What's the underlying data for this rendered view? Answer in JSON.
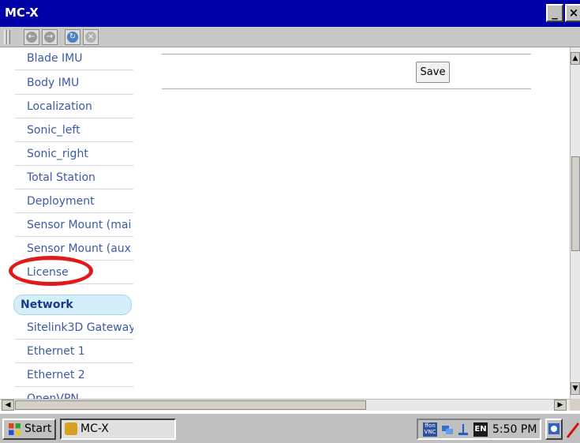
{
  "window": {
    "title": "MC-X",
    "minimize_label": "_",
    "close_label": "×"
  },
  "toolbar": {
    "back_glyph": "←",
    "forward_glyph": "→",
    "refresh_glyph": "↻",
    "stop_glyph": "×"
  },
  "sidebar": {
    "items": [
      {
        "label": "Blade IMU"
      },
      {
        "label": "Body IMU"
      },
      {
        "label": "Localization"
      },
      {
        "label": "Sonic_left"
      },
      {
        "label": "Sonic_right"
      },
      {
        "label": "Total Station"
      },
      {
        "label": "Deployment"
      },
      {
        "label": "Sensor Mount (mai"
      },
      {
        "label": "Sensor Mount (aux"
      },
      {
        "label": "License"
      }
    ],
    "section": {
      "label": "Network"
    },
    "network_items": [
      {
        "label": "Sitelink3D Gateway"
      },
      {
        "label": "Ethernet 1"
      },
      {
        "label": "Ethernet 2"
      },
      {
        "label": "OpenVPN"
      }
    ]
  },
  "content": {
    "save_label": "Save"
  },
  "annotation": {
    "color": "#e31919",
    "target": "License"
  },
  "taskbar": {
    "start_label": "Start",
    "task_label": "MC-X",
    "tray_vnc": "ffon VNC",
    "tray_lang": "EN",
    "clock": "5:50 PM"
  },
  "colors": {
    "titlebar": "#0000a8",
    "nav_text": "#3a5aa8",
    "section_bg": "#d4eefa"
  }
}
